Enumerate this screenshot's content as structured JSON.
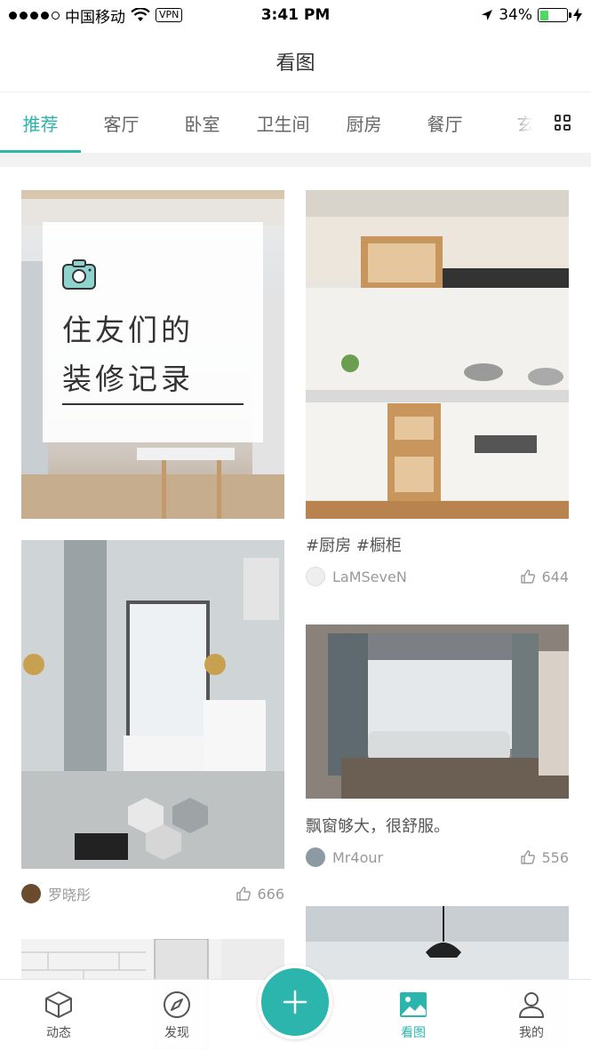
{
  "status_bar": {
    "carrier": "中国移动",
    "vpn": "VPN",
    "time": "3:41 PM",
    "battery": "34%",
    "battery_level": 0.34
  },
  "nav": {
    "title": "看图"
  },
  "tabs": {
    "items": [
      {
        "label": "推荐",
        "active": true
      },
      {
        "label": "客厅"
      },
      {
        "label": "卧室"
      },
      {
        "label": "卫生间"
      },
      {
        "label": "厨房"
      },
      {
        "label": "餐厅"
      },
      {
        "label": "玄"
      }
    ],
    "grid_icon": "grid-icon"
  },
  "feed": {
    "promo": {
      "icon": "camera-icon",
      "line1": "住友们的",
      "line2": "装修记录"
    },
    "card_kitchen": {
      "tags": "#厨房 #橱柜",
      "author": "LaMSeveN",
      "likes": "644"
    },
    "card_hallway": {
      "author": "罗晓彤",
      "likes": "666"
    },
    "card_bay_window": {
      "caption": "飘窗够大，很舒服。",
      "author": "Mr4our",
      "likes": "556"
    }
  },
  "tabbar": {
    "items": [
      {
        "label": "动态",
        "icon": "cube-icon"
      },
      {
        "label": "发现",
        "icon": "compass-icon"
      },
      {
        "label": "看图",
        "icon": "picture-icon",
        "active": true
      },
      {
        "label": "我的",
        "icon": "person-icon"
      }
    ],
    "add_icon": "plus-icon"
  },
  "colors": {
    "accent": "#2bb5ad",
    "battery_green": "#4cd964"
  }
}
